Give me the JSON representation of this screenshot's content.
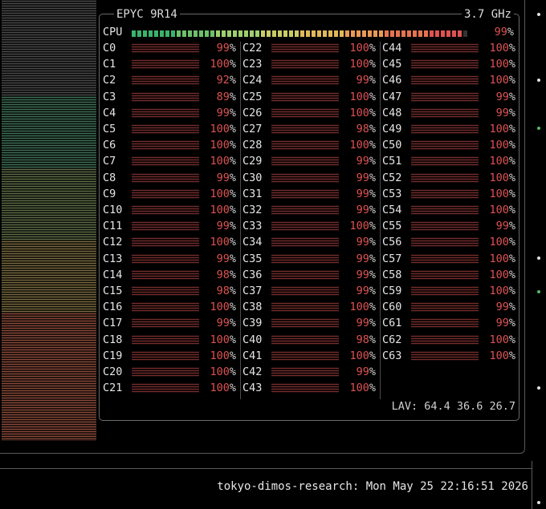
{
  "cpu_box": {
    "title": "EPYC 9R14",
    "freq": "3.7 GHz",
    "total_label": "CPU",
    "total_value": "99",
    "pct_sign": "%",
    "lav": "LAV: 64.4 36.6 26.7"
  },
  "cores_col1": [
    {
      "name": "C0",
      "value": "99"
    },
    {
      "name": "C1",
      "value": "100"
    },
    {
      "name": "C2",
      "value": "92"
    },
    {
      "name": "C3",
      "value": "89"
    },
    {
      "name": "C4",
      "value": "99"
    },
    {
      "name": "C5",
      "value": "100"
    },
    {
      "name": "C6",
      "value": "100"
    },
    {
      "name": "C7",
      "value": "100"
    },
    {
      "name": "C8",
      "value": "99"
    },
    {
      "name": "C9",
      "value": "100"
    },
    {
      "name": "C10",
      "value": "100"
    },
    {
      "name": "C11",
      "value": "99"
    },
    {
      "name": "C12",
      "value": "100"
    },
    {
      "name": "C13",
      "value": "99"
    },
    {
      "name": "C14",
      "value": "98"
    },
    {
      "name": "C15",
      "value": "98"
    },
    {
      "name": "C16",
      "value": "100"
    },
    {
      "name": "C17",
      "value": "99"
    },
    {
      "name": "C18",
      "value": "100"
    },
    {
      "name": "C19",
      "value": "100"
    },
    {
      "name": "C20",
      "value": "100"
    },
    {
      "name": "C21",
      "value": "100"
    }
  ],
  "cores_col2": [
    {
      "name": "C22",
      "value": "100"
    },
    {
      "name": "C23",
      "value": "100"
    },
    {
      "name": "C24",
      "value": "99"
    },
    {
      "name": "C25",
      "value": "100"
    },
    {
      "name": "C26",
      "value": "100"
    },
    {
      "name": "C27",
      "value": "98"
    },
    {
      "name": "C28",
      "value": "100"
    },
    {
      "name": "C29",
      "value": "99"
    },
    {
      "name": "C30",
      "value": "99"
    },
    {
      "name": "C31",
      "value": "99"
    },
    {
      "name": "C32",
      "value": "99"
    },
    {
      "name": "C33",
      "value": "100"
    },
    {
      "name": "C34",
      "value": "99"
    },
    {
      "name": "C35",
      "value": "99"
    },
    {
      "name": "C36",
      "value": "99"
    },
    {
      "name": "C37",
      "value": "99"
    },
    {
      "name": "C38",
      "value": "100"
    },
    {
      "name": "C39",
      "value": "99"
    },
    {
      "name": "C40",
      "value": "98"
    },
    {
      "name": "C41",
      "value": "100"
    },
    {
      "name": "C42",
      "value": "99"
    },
    {
      "name": "C43",
      "value": "100"
    }
  ],
  "cores_col3": [
    {
      "name": "C44",
      "value": "100"
    },
    {
      "name": "C45",
      "value": "100"
    },
    {
      "name": "C46",
      "value": "100"
    },
    {
      "name": "C47",
      "value": "99"
    },
    {
      "name": "C48",
      "value": "99"
    },
    {
      "name": "C49",
      "value": "100"
    },
    {
      "name": "C50",
      "value": "100"
    },
    {
      "name": "C51",
      "value": "100"
    },
    {
      "name": "C52",
      "value": "100"
    },
    {
      "name": "C53",
      "value": "100"
    },
    {
      "name": "C54",
      "value": "100"
    },
    {
      "name": "C55",
      "value": "99"
    },
    {
      "name": "C56",
      "value": "100"
    },
    {
      "name": "C57",
      "value": "100"
    },
    {
      "name": "C58",
      "value": "100"
    },
    {
      "name": "C59",
      "value": "100"
    },
    {
      "name": "C60",
      "value": "99"
    },
    {
      "name": "C61",
      "value": "99"
    },
    {
      "name": "C62",
      "value": "100"
    },
    {
      "name": "C63",
      "value": "100"
    }
  ],
  "footer": {
    "text": "tokyo-dimos-research: Mon May 25 22:16:51 2026"
  },
  "colors": {
    "accent_red": "#e05252",
    "bar_gradient": [
      "#3bb36b",
      "#6cc06a",
      "#9fcf6e",
      "#c9cc66",
      "#e0b85a",
      "#e89a55",
      "#e4744f",
      "#e05252"
    ]
  }
}
